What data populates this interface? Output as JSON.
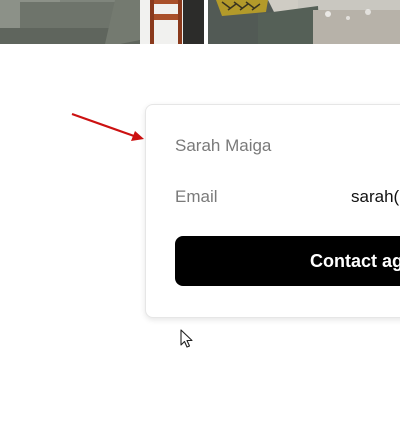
{
  "agent": {
    "name": "Sarah Maiga",
    "email_label": "Email",
    "email_value": "sarah(",
    "contact_label": "Contact ag"
  },
  "colors": {
    "button_bg": "#000000",
    "button_text": "#ffffff",
    "label_text": "#7a7a7a",
    "annotation_arrow": "#cc1111"
  },
  "icons": {
    "annotation": "arrow-annotation-icon",
    "cursor": "mouse-pointer-icon"
  }
}
